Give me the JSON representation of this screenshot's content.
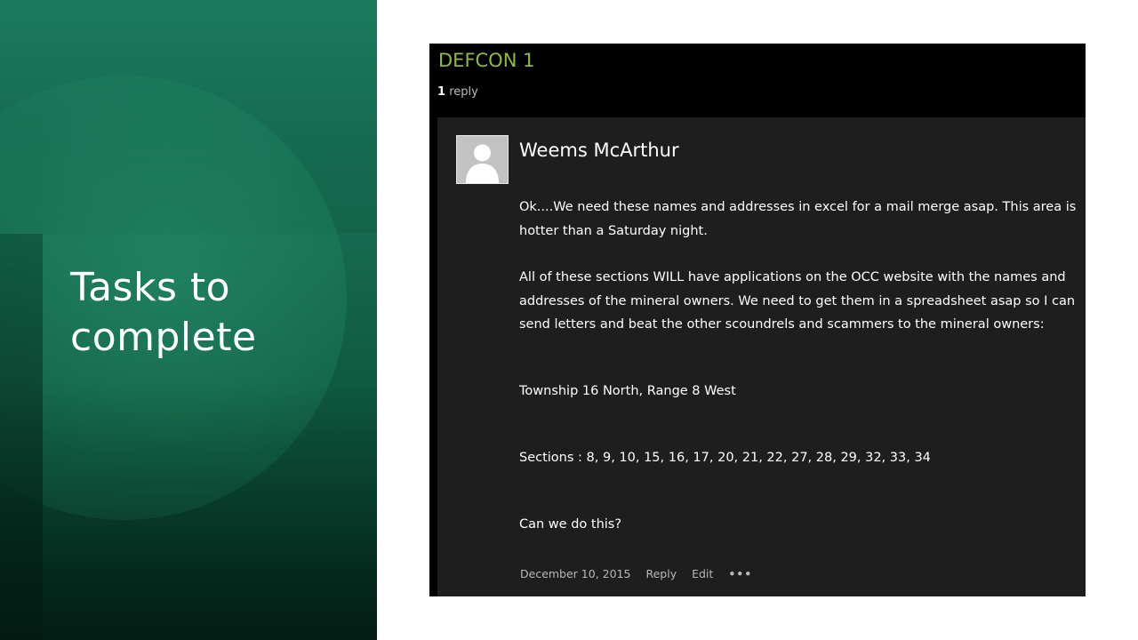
{
  "slide": {
    "title_line1": "Tasks to",
    "title_line2": "complete"
  },
  "forum": {
    "thread_title": "DEFCON 1",
    "reply_count": "1",
    "reply_label": "reply",
    "post": {
      "author": "Weems McArthur",
      "avatar_icon": "default-user-avatar-icon",
      "paragraphs": [
        "Ok....We need these names and addresses in excel for a mail merge asap.  This area is hotter than a Saturday night.",
        "All of these sections WILL have applications on the OCC website with the names and addresses of the mineral owners.  We need to get them in a spreadsheet asap so I can send letters and beat the other scoundrels and scammers to the mineral owners:",
        "Township 16 North, Range 8 West",
        "Sections : 8, 9, 10, 15, 16, 17, 20, 21, 22, 27, 28, 29, 32, 33, 34",
        "Can we do this?"
      ],
      "date": "December 10, 2015",
      "reply_button": "Reply",
      "edit_button": "Edit",
      "more_button": "•••",
      "more_icon": "more-options-icon"
    }
  },
  "colors": {
    "panel_green": "#1a7a5c",
    "title_accent": "#8fbc3c",
    "forum_bg": "#000000",
    "post_bg": "#1e1e1e"
  }
}
